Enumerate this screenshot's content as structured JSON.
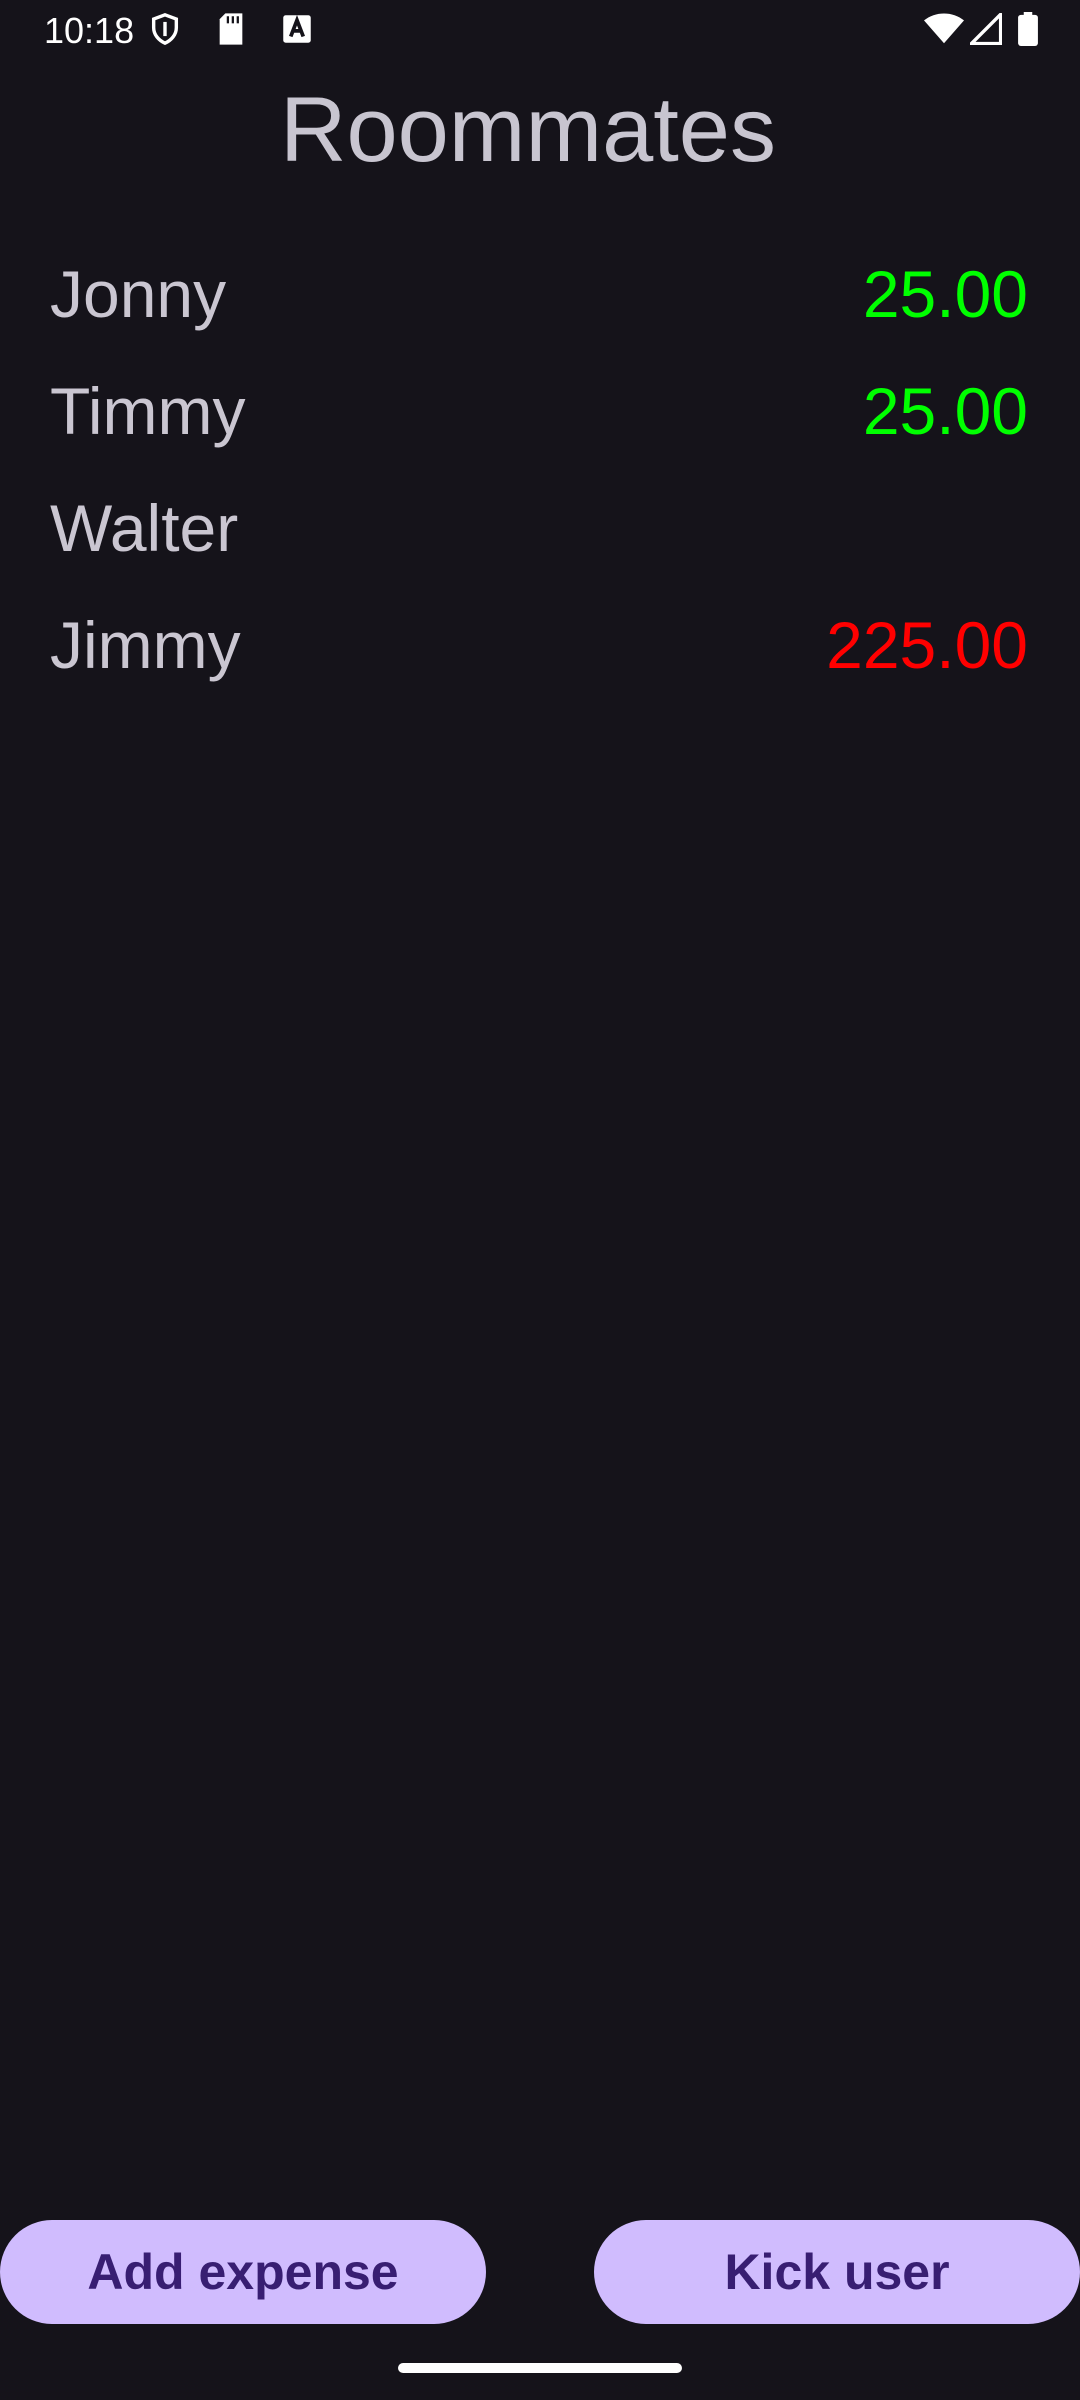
{
  "status_bar": {
    "time": "10:18",
    "left_icons": [
      "shield-icon",
      "sd-card-icon",
      "keyboard-a-icon"
    ],
    "right_icons": [
      "wifi-icon",
      "signal-icon",
      "battery-icon"
    ]
  },
  "page": {
    "title": "Roommates"
  },
  "roommates": [
    {
      "name": "Jonny",
      "amount": "25.00",
      "status": "positive"
    },
    {
      "name": "Timmy",
      "amount": "25.00",
      "status": "positive"
    },
    {
      "name": "Walter",
      "amount": "",
      "status": "none"
    },
    {
      "name": "Jimmy",
      "amount": "225.00",
      "status": "negative"
    }
  ],
  "actions": {
    "add_expense_label": "Add expense",
    "kick_user_label": "Kick user"
  },
  "colors": {
    "background": "#15131a",
    "text": "#cac6d1",
    "positive": "#00ff00",
    "negative": "#ff0000",
    "button_bg": "#d0bcfe",
    "button_text": "#381e72"
  }
}
